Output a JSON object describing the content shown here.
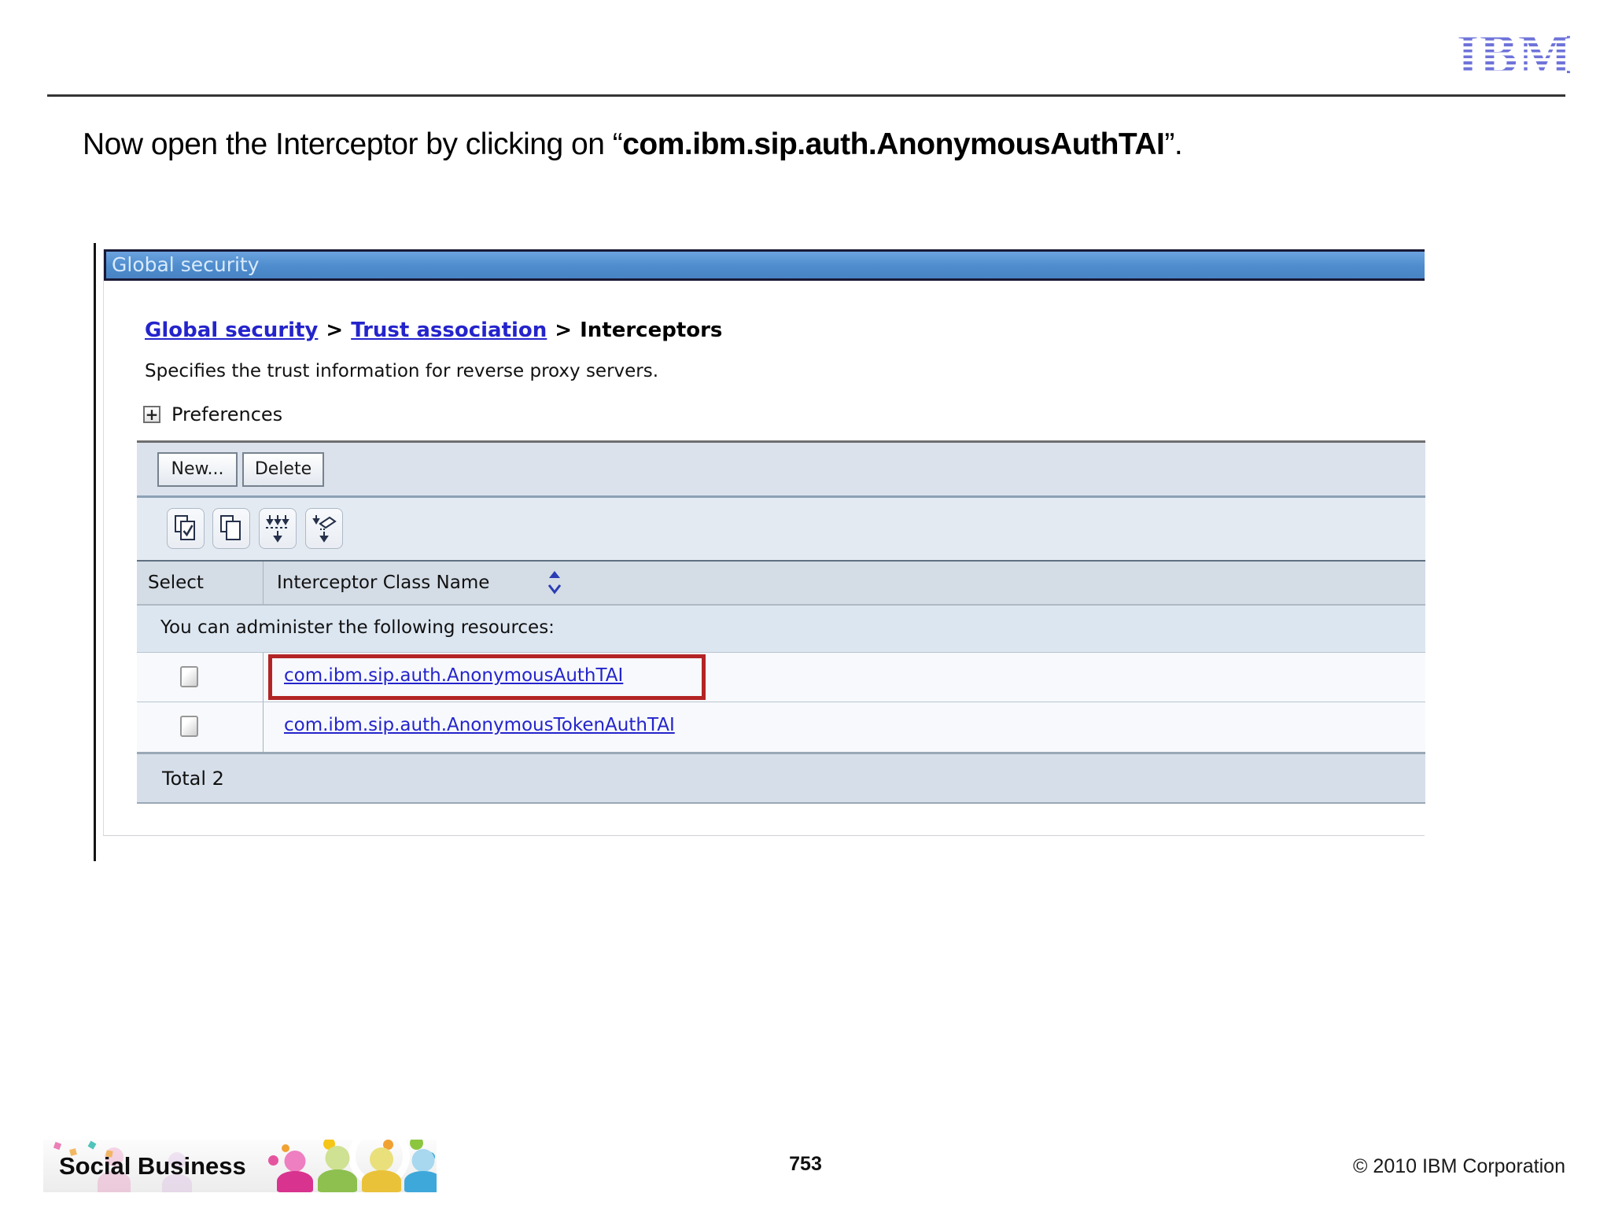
{
  "header": {
    "logo_text": "IBM"
  },
  "title": {
    "prefix": "Now open the Interceptor by clicking on “",
    "emphasis": "com.ibm.sip.auth.AnonymousAuthTAI",
    "suffix": "”."
  },
  "console": {
    "window_title": "Global security",
    "breadcrumb": {
      "items": [
        {
          "label": "Global security"
        },
        {
          "label": "Trust association"
        },
        {
          "label": "Interceptors"
        }
      ],
      "separator": ">"
    },
    "description": "Specifies the trust information for reverse proxy servers.",
    "preferences": {
      "label": "Preferences",
      "expand_icon": "+"
    },
    "actions": {
      "new_label": "New...",
      "delete_label": "Delete"
    },
    "toolbar": {
      "icons": [
        "select-all-items",
        "deselect-all-items",
        "show-filter-row",
        "clear-filter-value"
      ]
    },
    "table": {
      "select_column": "Select",
      "class_column": "Interceptor Class Name",
      "caption": "You can administer the following resources:",
      "rows": [
        {
          "class_name": "com.ibm.sip.auth.AnonymousAuthTAI",
          "highlighted": true
        },
        {
          "class_name": "com.ibm.sip.auth.AnonymousTokenAuthTAI",
          "highlighted": false
        }
      ],
      "total_label": "Total 2"
    },
    "colors": {
      "titlebar_blue": "#4e8ccd",
      "link_blue": "#2424cc",
      "highlight_red": "#b32424"
    }
  },
  "footer": {
    "brand": "Social Business",
    "page_number": "753",
    "copyright": "© 2010 IBM Corporation"
  },
  "colors": {
    "ibm_logo_blue": "#6e73d9"
  }
}
